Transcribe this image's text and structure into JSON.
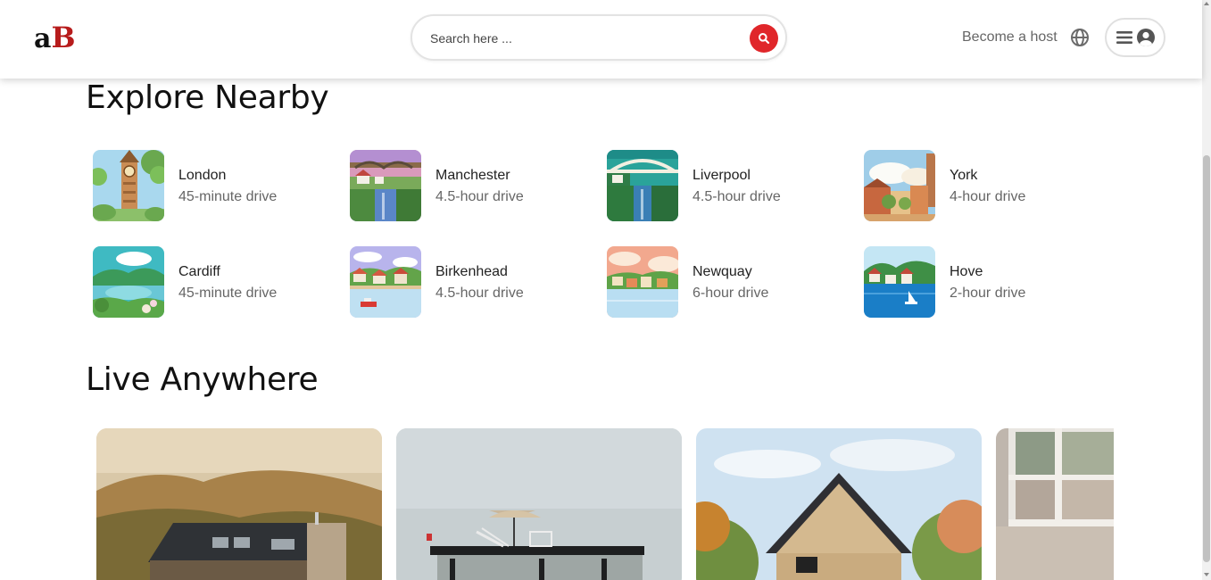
{
  "header": {
    "logo_a": "a",
    "logo_b": "B",
    "search_placeholder": "Search here ...",
    "become_host": "Become a host"
  },
  "colors": {
    "accent": "#e0262a",
    "logo_red": "#b71c1c"
  },
  "icons": {
    "search": "search-icon",
    "globe": "globe-icon",
    "menu": "hamburger-icon",
    "user": "user-circle-icon"
  },
  "explore": {
    "title": "Explore Nearby",
    "places": [
      {
        "name": "London",
        "distance": "45-minute drive"
      },
      {
        "name": "Manchester",
        "distance": "4.5-hour drive"
      },
      {
        "name": "Liverpool",
        "distance": "4.5-hour drive"
      },
      {
        "name": "York",
        "distance": "4-hour drive"
      },
      {
        "name": "Cardiff",
        "distance": "45-minute drive"
      },
      {
        "name": "Birkenhead",
        "distance": "4.5-hour drive"
      },
      {
        "name": "Newquay",
        "distance": "6-hour drive"
      },
      {
        "name": "Hove",
        "distance": "2-hour drive"
      }
    ]
  },
  "live": {
    "title": "Live Anywhere"
  }
}
